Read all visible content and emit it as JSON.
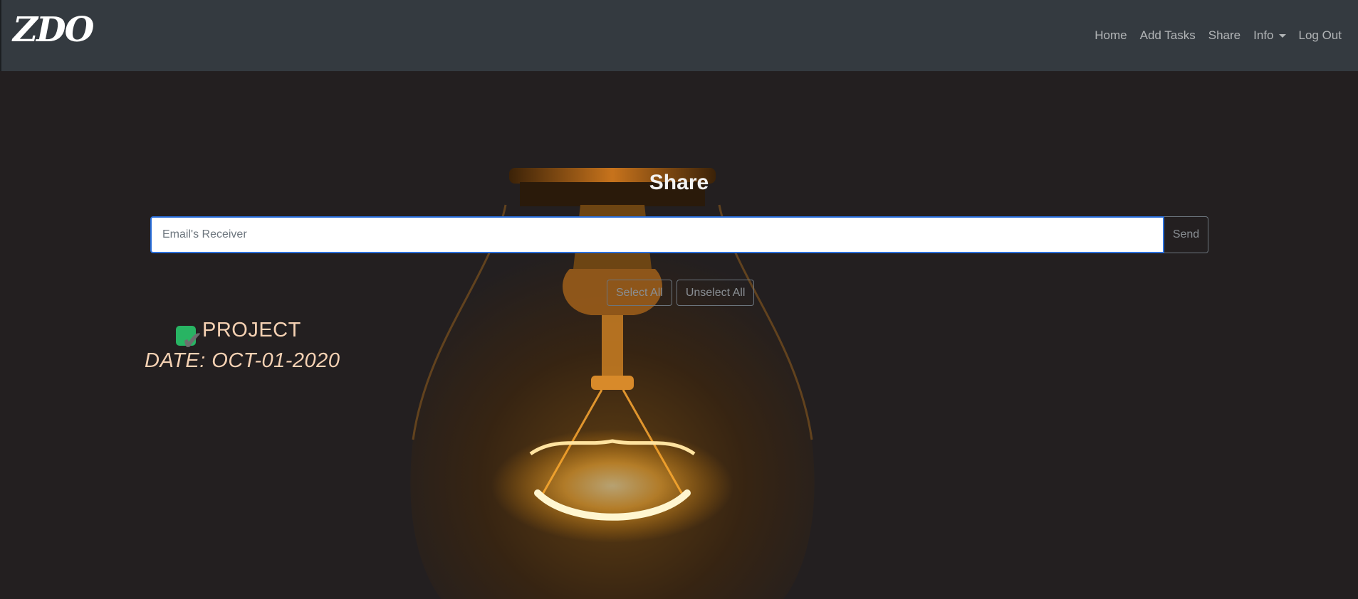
{
  "brand": {
    "logo_text": "ZDO"
  },
  "nav": {
    "links": [
      "Home",
      "Add Tasks",
      "Share",
      "Info",
      "Log Out"
    ]
  },
  "share": {
    "title": "Share",
    "email_placeholder": "Email's Receiver",
    "email_value": "",
    "send_label": "Send"
  },
  "selection": {
    "select_all_label": "Select All",
    "unselect_all_label": "Unselect All"
  },
  "task": {
    "name": "PROJECT",
    "date": "DATE: OCT-01-2020",
    "checked": true
  },
  "colors": {
    "navbar": "#343a40",
    "background": "#231f20",
    "checkbox": "#28b463",
    "task_text": "#f5d1b3",
    "input_focus": "#2a6fdb"
  },
  "icons": [
    "caret-down-icon",
    "check-icon",
    "light-bulb-image"
  ]
}
